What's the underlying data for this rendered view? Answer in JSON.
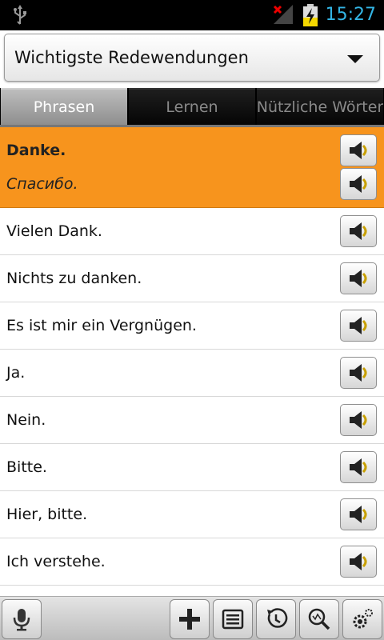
{
  "status": {
    "time": "15:27"
  },
  "dropdown": {
    "selected": "Wichtigste Redewendungen"
  },
  "tabs": [
    {
      "label": "Phrasen",
      "active": true
    },
    {
      "label": "Lernen",
      "active": false
    },
    {
      "label": "Nützliche Wörter",
      "active": false
    }
  ],
  "selected_phrase": {
    "text": "Danke.",
    "translation": "Спасибо."
  },
  "phrases": [
    "Vielen Dank.",
    "Nichts zu danken.",
    "Es ist mir ein Vergnügen.",
    "Ja.",
    "Nein.",
    "Bitte.",
    "Hier, bitte.",
    "Ich verstehe."
  ],
  "colors": {
    "selected_row": "#f7941d",
    "clock": "#33b5e5",
    "active_tab": "#a8a8a8"
  },
  "icons": {
    "usb": "usb-icon",
    "signal": "signal-icon",
    "battery": "battery-charging-icon",
    "speaker": "speaker-icon",
    "microphone": "microphone-icon",
    "add": "plus-icon",
    "list": "list-icon",
    "history": "history-icon",
    "search": "search-icon",
    "settings": "gear-icon"
  }
}
